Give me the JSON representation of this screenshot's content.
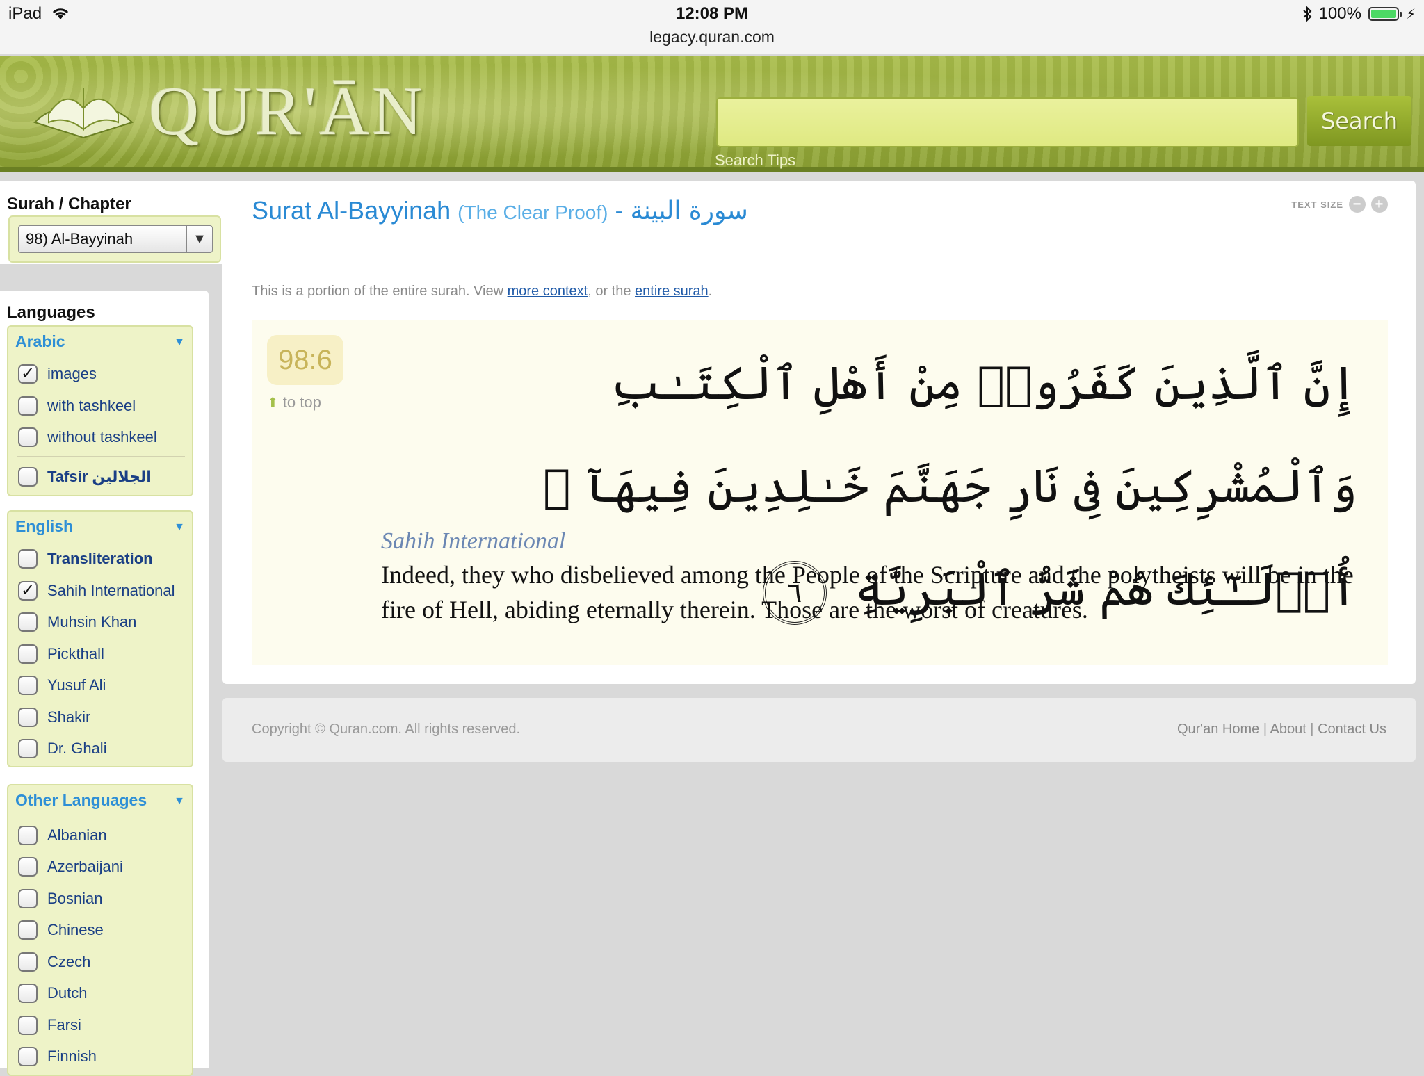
{
  "status": {
    "device": "iPad",
    "time": "12:08 PM",
    "url": "legacy.quran.com",
    "battery": "100%"
  },
  "header": {
    "logo_text": "QUR'ĀN",
    "search_placeholder": "",
    "search_button": "Search",
    "search_tips": "Search Tips"
  },
  "sidebar": {
    "chapter_heading": "Surah / Chapter",
    "chapter_value": "98) Al-Bayyinah",
    "languages_heading": "Languages",
    "arabic": {
      "title": "Arabic",
      "options": [
        {
          "label": "images",
          "checked": true
        },
        {
          "label": "with tashkeel",
          "checked": false
        },
        {
          "label": "without tashkeel",
          "checked": false
        },
        {
          "label": "Tafsir الجلالين",
          "checked": false
        }
      ]
    },
    "english": {
      "title": "English",
      "options": [
        {
          "label": "Transliteration",
          "checked": false
        },
        {
          "label": "Sahih International",
          "checked": true
        },
        {
          "label": "Muhsin Khan",
          "checked": false
        },
        {
          "label": "Pickthall",
          "checked": false
        },
        {
          "label": "Yusuf Ali",
          "checked": false
        },
        {
          "label": "Shakir",
          "checked": false
        },
        {
          "label": "Dr. Ghali",
          "checked": false
        }
      ]
    },
    "other": {
      "title": "Other Languages",
      "options": [
        {
          "label": "Albanian",
          "checked": false
        },
        {
          "label": "Azerbaijani",
          "checked": false
        },
        {
          "label": "Bosnian",
          "checked": false
        },
        {
          "label": "Chinese",
          "checked": false
        },
        {
          "label": "Czech",
          "checked": false
        },
        {
          "label": "Dutch",
          "checked": false
        },
        {
          "label": "Farsi",
          "checked": false
        },
        {
          "label": "Finnish",
          "checked": false
        }
      ]
    }
  },
  "main": {
    "title": "Surat Al-Bayyinah",
    "subtitle": "(The Clear Proof)",
    "separator": " - ",
    "arabic_title": "سورة البينة",
    "text_size_label": "TEXT SIZE",
    "portion": {
      "prefix": "This is a portion of the entire surah. View ",
      "link1": "more context",
      "middle": ", or the ",
      "link2": "entire surah",
      "suffix": "."
    },
    "verse": {
      "number": "98:6",
      "to_top": "to top",
      "arabic": "إِنَّ ٱلَّذِينَ كَفَرُوا۟ مِنْ أَهْلِ ٱلْكِتَـٰبِ وَٱلْمُشْرِكِينَ فِى نَارِ جَهَنَّمَ خَـٰلِدِينَ فِيهَآ ۚ أُو۟لَـٰٓئِكَ هُمْ شَرُّ ٱلْبَرِيَّةِ",
      "ayah_number": "٦",
      "translator": "Sahih International",
      "translation": "Indeed, they who disbelieved among the People of the Scripture and the polytheists will be in the fire of Hell, abiding eternally therein. Those are the worst of creatures."
    }
  },
  "footer": {
    "copyright": "Copyright © Quran.com. All rights reserved.",
    "links": [
      "Qur'an Home",
      "About",
      "Contact Us"
    ],
    "separator": " | "
  },
  "colors": {
    "accent_blue": "#2a8ad4",
    "header_green": "#8ea334",
    "panel_green": "#eef3c8"
  }
}
